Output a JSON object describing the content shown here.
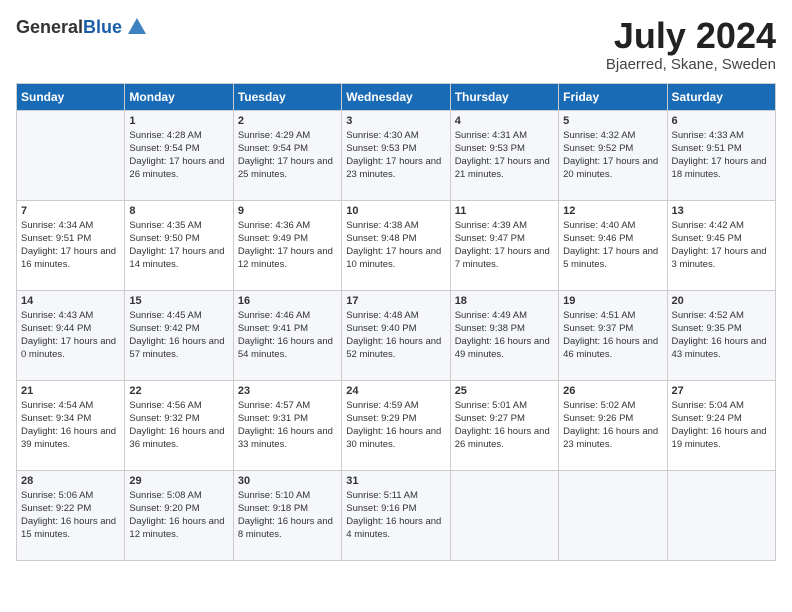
{
  "header": {
    "logo_general": "General",
    "logo_blue": "Blue",
    "month_year": "July 2024",
    "location": "Bjaerred, Skane, Sweden"
  },
  "days_of_week": [
    "Sunday",
    "Monday",
    "Tuesday",
    "Wednesday",
    "Thursday",
    "Friday",
    "Saturday"
  ],
  "weeks": [
    [
      {
        "day": "",
        "sunrise": "",
        "sunset": "",
        "daylight": ""
      },
      {
        "day": "1",
        "sunrise": "Sunrise: 4:28 AM",
        "sunset": "Sunset: 9:54 PM",
        "daylight": "Daylight: 17 hours and 26 minutes."
      },
      {
        "day": "2",
        "sunrise": "Sunrise: 4:29 AM",
        "sunset": "Sunset: 9:54 PM",
        "daylight": "Daylight: 17 hours and 25 minutes."
      },
      {
        "day": "3",
        "sunrise": "Sunrise: 4:30 AM",
        "sunset": "Sunset: 9:53 PM",
        "daylight": "Daylight: 17 hours and 23 minutes."
      },
      {
        "day": "4",
        "sunrise": "Sunrise: 4:31 AM",
        "sunset": "Sunset: 9:53 PM",
        "daylight": "Daylight: 17 hours and 21 minutes."
      },
      {
        "day": "5",
        "sunrise": "Sunrise: 4:32 AM",
        "sunset": "Sunset: 9:52 PM",
        "daylight": "Daylight: 17 hours and 20 minutes."
      },
      {
        "day": "6",
        "sunrise": "Sunrise: 4:33 AM",
        "sunset": "Sunset: 9:51 PM",
        "daylight": "Daylight: 17 hours and 18 minutes."
      }
    ],
    [
      {
        "day": "7",
        "sunrise": "Sunrise: 4:34 AM",
        "sunset": "Sunset: 9:51 PM",
        "daylight": "Daylight: 17 hours and 16 minutes."
      },
      {
        "day": "8",
        "sunrise": "Sunrise: 4:35 AM",
        "sunset": "Sunset: 9:50 PM",
        "daylight": "Daylight: 17 hours and 14 minutes."
      },
      {
        "day": "9",
        "sunrise": "Sunrise: 4:36 AM",
        "sunset": "Sunset: 9:49 PM",
        "daylight": "Daylight: 17 hours and 12 minutes."
      },
      {
        "day": "10",
        "sunrise": "Sunrise: 4:38 AM",
        "sunset": "Sunset: 9:48 PM",
        "daylight": "Daylight: 17 hours and 10 minutes."
      },
      {
        "day": "11",
        "sunrise": "Sunrise: 4:39 AM",
        "sunset": "Sunset: 9:47 PM",
        "daylight": "Daylight: 17 hours and 7 minutes."
      },
      {
        "day": "12",
        "sunrise": "Sunrise: 4:40 AM",
        "sunset": "Sunset: 9:46 PM",
        "daylight": "Daylight: 17 hours and 5 minutes."
      },
      {
        "day": "13",
        "sunrise": "Sunrise: 4:42 AM",
        "sunset": "Sunset: 9:45 PM",
        "daylight": "Daylight: 17 hours and 3 minutes."
      }
    ],
    [
      {
        "day": "14",
        "sunrise": "Sunrise: 4:43 AM",
        "sunset": "Sunset: 9:44 PM",
        "daylight": "Daylight: 17 hours and 0 minutes."
      },
      {
        "day": "15",
        "sunrise": "Sunrise: 4:45 AM",
        "sunset": "Sunset: 9:42 PM",
        "daylight": "Daylight: 16 hours and 57 minutes."
      },
      {
        "day": "16",
        "sunrise": "Sunrise: 4:46 AM",
        "sunset": "Sunset: 9:41 PM",
        "daylight": "Daylight: 16 hours and 54 minutes."
      },
      {
        "day": "17",
        "sunrise": "Sunrise: 4:48 AM",
        "sunset": "Sunset: 9:40 PM",
        "daylight": "Daylight: 16 hours and 52 minutes."
      },
      {
        "day": "18",
        "sunrise": "Sunrise: 4:49 AM",
        "sunset": "Sunset: 9:38 PM",
        "daylight": "Daylight: 16 hours and 49 minutes."
      },
      {
        "day": "19",
        "sunrise": "Sunrise: 4:51 AM",
        "sunset": "Sunset: 9:37 PM",
        "daylight": "Daylight: 16 hours and 46 minutes."
      },
      {
        "day": "20",
        "sunrise": "Sunrise: 4:52 AM",
        "sunset": "Sunset: 9:35 PM",
        "daylight": "Daylight: 16 hours and 43 minutes."
      }
    ],
    [
      {
        "day": "21",
        "sunrise": "Sunrise: 4:54 AM",
        "sunset": "Sunset: 9:34 PM",
        "daylight": "Daylight: 16 hours and 39 minutes."
      },
      {
        "day": "22",
        "sunrise": "Sunrise: 4:56 AM",
        "sunset": "Sunset: 9:32 PM",
        "daylight": "Daylight: 16 hours and 36 minutes."
      },
      {
        "day": "23",
        "sunrise": "Sunrise: 4:57 AM",
        "sunset": "Sunset: 9:31 PM",
        "daylight": "Daylight: 16 hours and 33 minutes."
      },
      {
        "day": "24",
        "sunrise": "Sunrise: 4:59 AM",
        "sunset": "Sunset: 9:29 PM",
        "daylight": "Daylight: 16 hours and 30 minutes."
      },
      {
        "day": "25",
        "sunrise": "Sunrise: 5:01 AM",
        "sunset": "Sunset: 9:27 PM",
        "daylight": "Daylight: 16 hours and 26 minutes."
      },
      {
        "day": "26",
        "sunrise": "Sunrise: 5:02 AM",
        "sunset": "Sunset: 9:26 PM",
        "daylight": "Daylight: 16 hours and 23 minutes."
      },
      {
        "day": "27",
        "sunrise": "Sunrise: 5:04 AM",
        "sunset": "Sunset: 9:24 PM",
        "daylight": "Daylight: 16 hours and 19 minutes."
      }
    ],
    [
      {
        "day": "28",
        "sunrise": "Sunrise: 5:06 AM",
        "sunset": "Sunset: 9:22 PM",
        "daylight": "Daylight: 16 hours and 15 minutes."
      },
      {
        "day": "29",
        "sunrise": "Sunrise: 5:08 AM",
        "sunset": "Sunset: 9:20 PM",
        "daylight": "Daylight: 16 hours and 12 minutes."
      },
      {
        "day": "30",
        "sunrise": "Sunrise: 5:10 AM",
        "sunset": "Sunset: 9:18 PM",
        "daylight": "Daylight: 16 hours and 8 minutes."
      },
      {
        "day": "31",
        "sunrise": "Sunrise: 5:11 AM",
        "sunset": "Sunset: 9:16 PM",
        "daylight": "Daylight: 16 hours and 4 minutes."
      },
      {
        "day": "",
        "sunrise": "",
        "sunset": "",
        "daylight": ""
      },
      {
        "day": "",
        "sunrise": "",
        "sunset": "",
        "daylight": ""
      },
      {
        "day": "",
        "sunrise": "",
        "sunset": "",
        "daylight": ""
      }
    ]
  ]
}
